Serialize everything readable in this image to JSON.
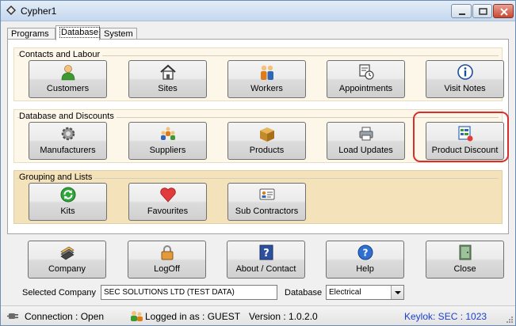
{
  "window": {
    "title": "Cypher1"
  },
  "tabs": [
    {
      "label": "Programs",
      "active": false
    },
    {
      "label": "Database",
      "active": true
    },
    {
      "label": "System",
      "active": false
    }
  ],
  "groups": {
    "contacts": {
      "title": "Contacts and Labour",
      "buttons": [
        {
          "label": "Customers",
          "icon": "person-icon"
        },
        {
          "label": "Sites",
          "icon": "house-icon"
        },
        {
          "label": "Workers",
          "icon": "workers-icon"
        },
        {
          "label": "Appointments",
          "icon": "calendar-clock-icon"
        },
        {
          "label": "Visit Notes",
          "icon": "info-icon"
        }
      ]
    },
    "database": {
      "title": "Database and Discounts",
      "buttons": [
        {
          "label": "Manufacturers",
          "icon": "gear-icon"
        },
        {
          "label": "Suppliers",
          "icon": "people-group-icon"
        },
        {
          "label": "Products",
          "icon": "box-icon"
        },
        {
          "label": "Load Updates",
          "icon": "printer-icon"
        },
        {
          "label": "Product Discount",
          "icon": "price-list-icon"
        }
      ]
    },
    "grouping": {
      "title": "Grouping and Lists",
      "buttons": [
        {
          "label": "Kits",
          "icon": "refresh-icon"
        },
        {
          "label": "Favourites",
          "icon": "heart-icon"
        },
        {
          "label": "Sub Contractors",
          "icon": "id-card-icon"
        }
      ]
    }
  },
  "bottom_buttons": [
    {
      "label": "Company",
      "icon": "books-icon"
    },
    {
      "label": "LogOff",
      "icon": "padlock-icon"
    },
    {
      "label": "About / Contact",
      "icon": "question-box-icon"
    },
    {
      "label": "Help",
      "icon": "help-circle-icon"
    },
    {
      "label": "Close",
      "icon": "exit-door-icon"
    }
  ],
  "company": {
    "label": "Selected Company",
    "value": "SEC SOLUTIONS LTD (TEST DATA)",
    "database_label": "Database",
    "database_value": "Electrical"
  },
  "status": {
    "connection": "Connection : Open",
    "user": "Logged in as : GUEST",
    "version": "Version : 1.0.2.0",
    "keylok": "Keylok: SEC : 1023",
    "keylok_color": "#1a3fd0"
  }
}
